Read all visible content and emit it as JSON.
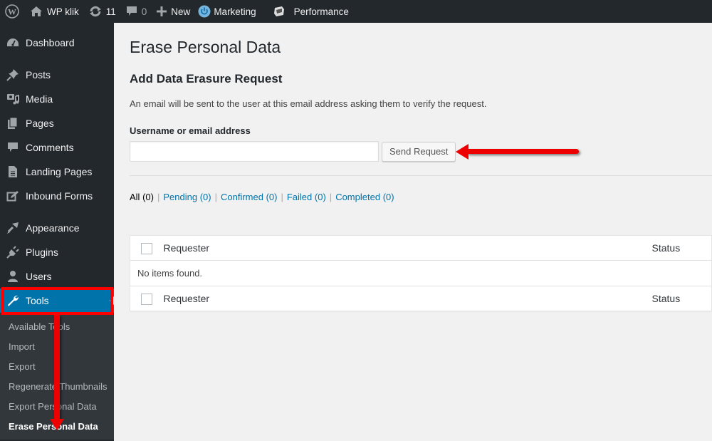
{
  "adminbar": {
    "site_name": "WP klik",
    "updates_count": "11",
    "comments_count": "0",
    "new_label": "New",
    "marketing_label": "Marketing",
    "performance_label": "Performance"
  },
  "sidebar": {
    "items": [
      {
        "label": "Dashboard",
        "icon": "dashboard-icon"
      },
      {
        "label": "Posts",
        "icon": "pin-icon"
      },
      {
        "label": "Media",
        "icon": "media-icon"
      },
      {
        "label": "Pages",
        "icon": "pages-icon"
      },
      {
        "label": "Comments",
        "icon": "comment-icon"
      },
      {
        "label": "Landing Pages",
        "icon": "document-icon"
      },
      {
        "label": "Inbound Forms",
        "icon": "edit-icon"
      },
      {
        "label": "Appearance",
        "icon": "brush-icon"
      },
      {
        "label": "Plugins",
        "icon": "plug-icon"
      },
      {
        "label": "Users",
        "icon": "user-icon"
      },
      {
        "label": "Tools",
        "icon": "wrench-icon"
      }
    ],
    "submenu": [
      "Available Tools",
      "Import",
      "Export",
      "Regenerate Thumbnails",
      "Export Personal Data",
      "Erase Personal Data"
    ]
  },
  "main": {
    "title": "Erase Personal Data",
    "section_title": "Add Data Erasure Request",
    "description": "An email will be sent to the user at this email address asking them to verify the request.",
    "field_label": "Username or email address",
    "field_value": "",
    "send_button": "Send Request",
    "filters": [
      {
        "label": "All",
        "count": "(0)"
      },
      {
        "label": "Pending",
        "count": "(0)"
      },
      {
        "label": "Confirmed",
        "count": "(0)"
      },
      {
        "label": "Failed",
        "count": "(0)"
      },
      {
        "label": "Completed",
        "count": "(0)"
      }
    ],
    "table": {
      "columns": [
        "Requester",
        "Status"
      ],
      "empty_message": "No items found."
    }
  },
  "colors": {
    "admin_dark": "#23282d",
    "submenu_bg": "#32373c",
    "accent": "#0073aa",
    "annotation_red": "#ee0000"
  }
}
